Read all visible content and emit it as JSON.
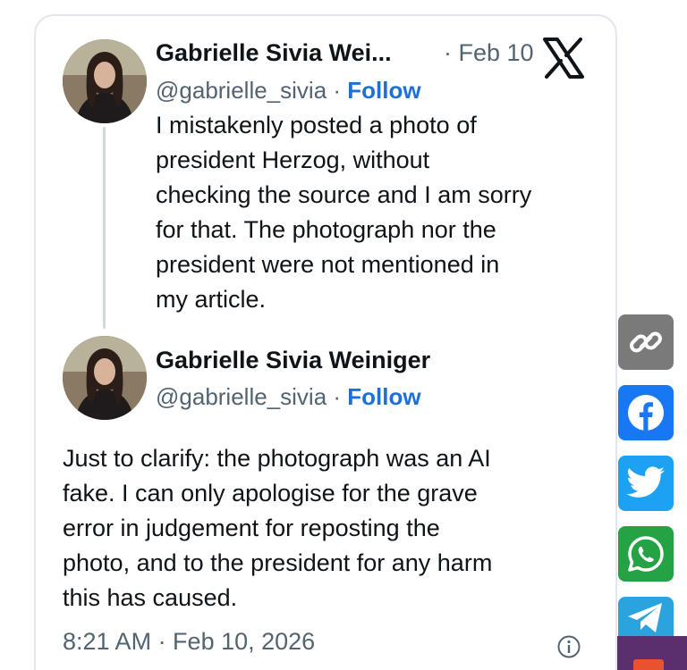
{
  "tweet1": {
    "name": "Gabrielle Sivia Wei...",
    "date": "· Feb 10",
    "handle": "@gabrielle_sivia",
    "follow": "Follow",
    "text_lines": [
      "I mistakenly posted a photo of",
      "president Herzog, without",
      "checking the source and I am sorry",
      "for that. The photograph nor the",
      "president were not mentioned in",
      "my article."
    ]
  },
  "tweet2": {
    "name": "Gabrielle Sivia Weiniger",
    "handle": "@gabrielle_sivia",
    "follow": "Follow",
    "text_lines": [
      "Just to clarify: the photograph was an AI",
      "fake. I can only apologise for the grave",
      "error in judgement for reposting the",
      "photo, and to the president for any harm",
      "this has caused."
    ],
    "timestamp": "8:21 AM · Feb 10, 2026"
  },
  "separator": "·",
  "icons": {
    "platform": "x-logo-icon",
    "info": "info-icon",
    "share": [
      "link-icon",
      "facebook-icon",
      "twitter-icon",
      "whatsapp-icon",
      "telegram-icon"
    ]
  },
  "colors": {
    "follow": "#1d70d8",
    "muted": "#536471",
    "link_btn": "#7a7a7a",
    "facebook": "#1877f2",
    "twitter": "#1da1f2",
    "whatsapp": "#25a244",
    "telegram": "#2aa3df"
  }
}
